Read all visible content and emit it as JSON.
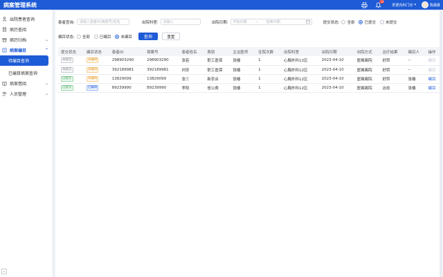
{
  "header": {
    "title": "病案管理系统",
    "notification_count": "10",
    "department": "肝胆内科门诊",
    "user_name": "陈晨晨"
  },
  "sidebar": {
    "items": [
      {
        "label": "出院患者查询",
        "icon": "person-icon"
      },
      {
        "label": "病历查阅",
        "icon": "document-icon"
      },
      {
        "label": "病历归档",
        "icon": "archive-icon"
      },
      {
        "label": "病案编目",
        "icon": "catalog-icon"
      },
      {
        "label": "病案借阅",
        "icon": "book-icon"
      },
      {
        "label": "人员管理",
        "icon": "people-icon"
      }
    ],
    "sub_items": [
      {
        "label": "待编目查询"
      },
      {
        "label": "已编目病案查询"
      }
    ],
    "collapse_icon": "chevron-left-icon"
  },
  "filters": {
    "patient_query_label": "患者查询:",
    "patient_query_placeholder": "请输入患者ID/病案号/姓名",
    "department_label": "出院科室:",
    "department_placeholder": "请输入",
    "discharge_date_label": "出院日期:",
    "start_date_placeholder": "开始日期",
    "date_separator": "~",
    "end_date_placeholder": "结束日期",
    "submit_status_label": "提交状态:",
    "submit_options": [
      "全部",
      "已提交",
      "未提交"
    ],
    "submit_selected": "已提交",
    "catalog_status_label": "编目状态:",
    "catalog_options": [
      "全部",
      "已编目",
      "未编目"
    ],
    "catalog_selected": "未编目",
    "search_button": "查询",
    "reset_button": "重置"
  },
  "table": {
    "columns": [
      "提交状态",
      "编目状态",
      "患者ID",
      "病案号",
      "患者姓名",
      "费别",
      "主治医师",
      "住院次数",
      "出院科室",
      "出院日期",
      "出院方式",
      "治疗结果",
      "编目人",
      "操作"
    ],
    "rows": [
      {
        "submit": "未提交",
        "submit_style": "gray",
        "catalog": "未编目",
        "catalog_style": "orange",
        "patient_id": "298903290",
        "record_no": "298903290",
        "name": "张若",
        "fee": "职工医保",
        "doctor": "张椿",
        "visits": "1",
        "dept": "心胸外科12区",
        "date": "2023-04-10",
        "method": "医嘱离院",
        "result": "好转",
        "cataloger": "--",
        "action": "编目",
        "action_active": false
      },
      {
        "submit": "未提交",
        "submit_style": "gray",
        "catalog": "未编目",
        "catalog_style": "orange",
        "patient_id": "392189981",
        "record_no": "392189981",
        "name": "刘安",
        "fee": "职工医保",
        "doctor": "张椿",
        "visits": "1",
        "dept": "心胸外科12区",
        "date": "2023-04-10",
        "method": "医嘱离院",
        "result": "好转",
        "cataloger": "--",
        "action": "编目",
        "action_active": false
      },
      {
        "submit": "已提交",
        "submit_style": "green",
        "catalog": "未编目",
        "catalog_style": "orange",
        "patient_id": "13829099",
        "record_no": "13829099",
        "name": "张三",
        "fee": "新农合",
        "doctor": "张椿",
        "visits": "1",
        "dept": "心胸外科12区",
        "date": "2023-04-10",
        "method": "医嘱离院",
        "result": "好转",
        "cataloger": "张椿",
        "action": "编目",
        "action_active": true
      },
      {
        "submit": "已提交",
        "submit_style": "green",
        "catalog": "已编目",
        "catalog_style": "blue",
        "patient_id": "89239990",
        "record_no": "89239990",
        "name": "李阳",
        "fee": "省公费",
        "doctor": "张椿",
        "visits": "1",
        "dept": "心胸外科12区",
        "date": "2023-04-10",
        "method": "医嘱离院",
        "result": "治愈",
        "cataloger": "张椿",
        "action": "编目",
        "action_active": true
      }
    ]
  }
}
